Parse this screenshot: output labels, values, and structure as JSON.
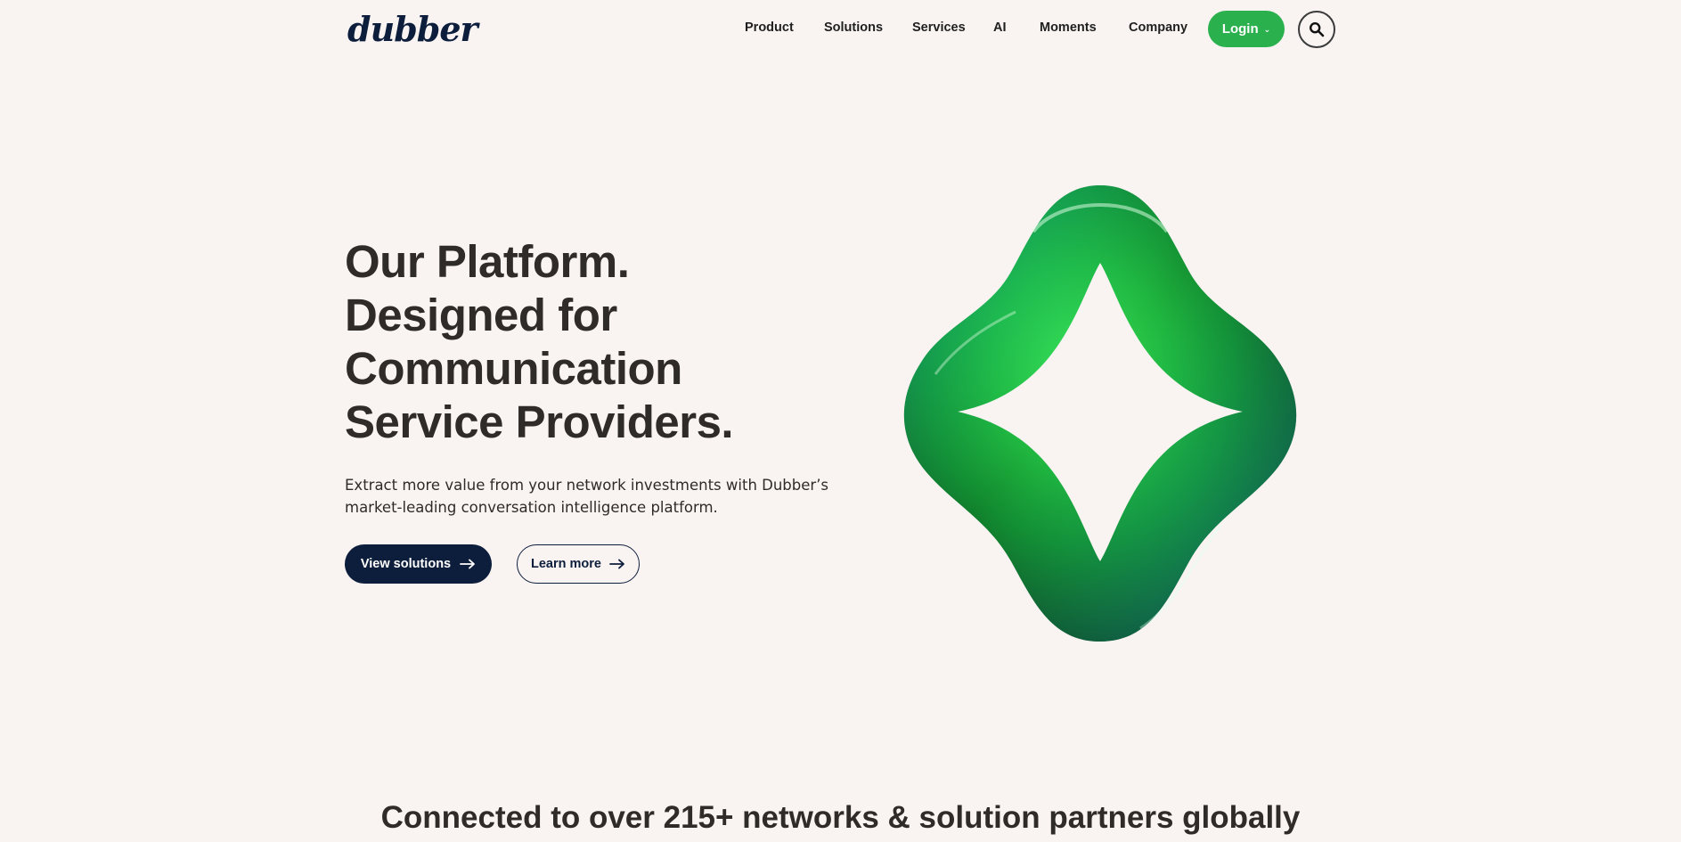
{
  "brand": {
    "logo_text": "dubber"
  },
  "nav": {
    "items": [
      {
        "label": "Product"
      },
      {
        "label": "Solutions"
      },
      {
        "label": "Services"
      },
      {
        "label": "AI"
      },
      {
        "label": "Moments"
      },
      {
        "label": "Company"
      }
    ],
    "login_label": "Login"
  },
  "hero": {
    "title_lines": [
      "Our Platform.",
      "Designed for",
      "Communication",
      "Service Providers."
    ],
    "subtitle_lines": [
      "Extract more value from your network investments with Dubber’s",
      "market-leading conversation intelligence platform."
    ],
    "primary_cta": "View solutions",
    "secondary_cta": "Learn more"
  },
  "partners": {
    "heading": "Connected to over 215+ networks & solution partners globally"
  },
  "icons": {
    "search": "search-icon",
    "login_chevron": "chevron-down-icon",
    "cta_arrow": "arrow-right-icon"
  },
  "colors": {
    "background": "#f9f4f2",
    "brand_navy": "#0d1e3c",
    "login_green": "#2bb04e",
    "text": "#2f2b29"
  }
}
